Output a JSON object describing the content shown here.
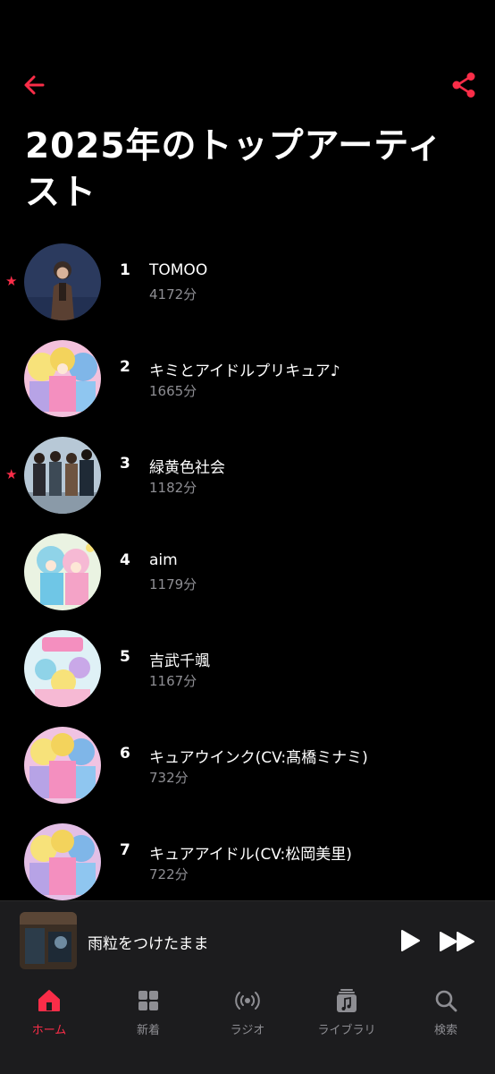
{
  "header": {
    "title": "2025年のトップアーティスト"
  },
  "artists": [
    {
      "rank": "1",
      "name": "TOMOO",
      "minutes": "4172分",
      "starred": true
    },
    {
      "rank": "2",
      "name": "キミとアイドルプリキュア♪",
      "minutes": "1665分",
      "starred": false
    },
    {
      "rank": "3",
      "name": "緑黄色社会",
      "minutes": "1182分",
      "starred": true
    },
    {
      "rank": "4",
      "name": "aim",
      "minutes": "1179分",
      "starred": false
    },
    {
      "rank": "5",
      "name": "吉武千颯",
      "minutes": "1167分",
      "starred": false
    },
    {
      "rank": "6",
      "name": "キュアウインク(CV:髙橋ミナミ)",
      "minutes": "732分",
      "starred": false
    },
    {
      "rank": "7",
      "name": "キュアアイドル(CV:松岡美里)",
      "minutes": "722分",
      "starred": false
    }
  ],
  "player": {
    "title": "雨粒をつけたまま"
  },
  "tabs": [
    {
      "label": "ホーム",
      "icon": "home-icon",
      "active": true
    },
    {
      "label": "新着",
      "icon": "grid-icon",
      "active": false
    },
    {
      "label": "ラジオ",
      "icon": "radio-icon",
      "active": false
    },
    {
      "label": "ライブラリ",
      "icon": "library-icon",
      "active": false
    },
    {
      "label": "検索",
      "icon": "search-icon",
      "active": false
    }
  ],
  "colors": {
    "accent": "#fa2d48",
    "background": "#000000",
    "secondary_text": "#8e8e93",
    "bar": "#1c1c1e"
  }
}
